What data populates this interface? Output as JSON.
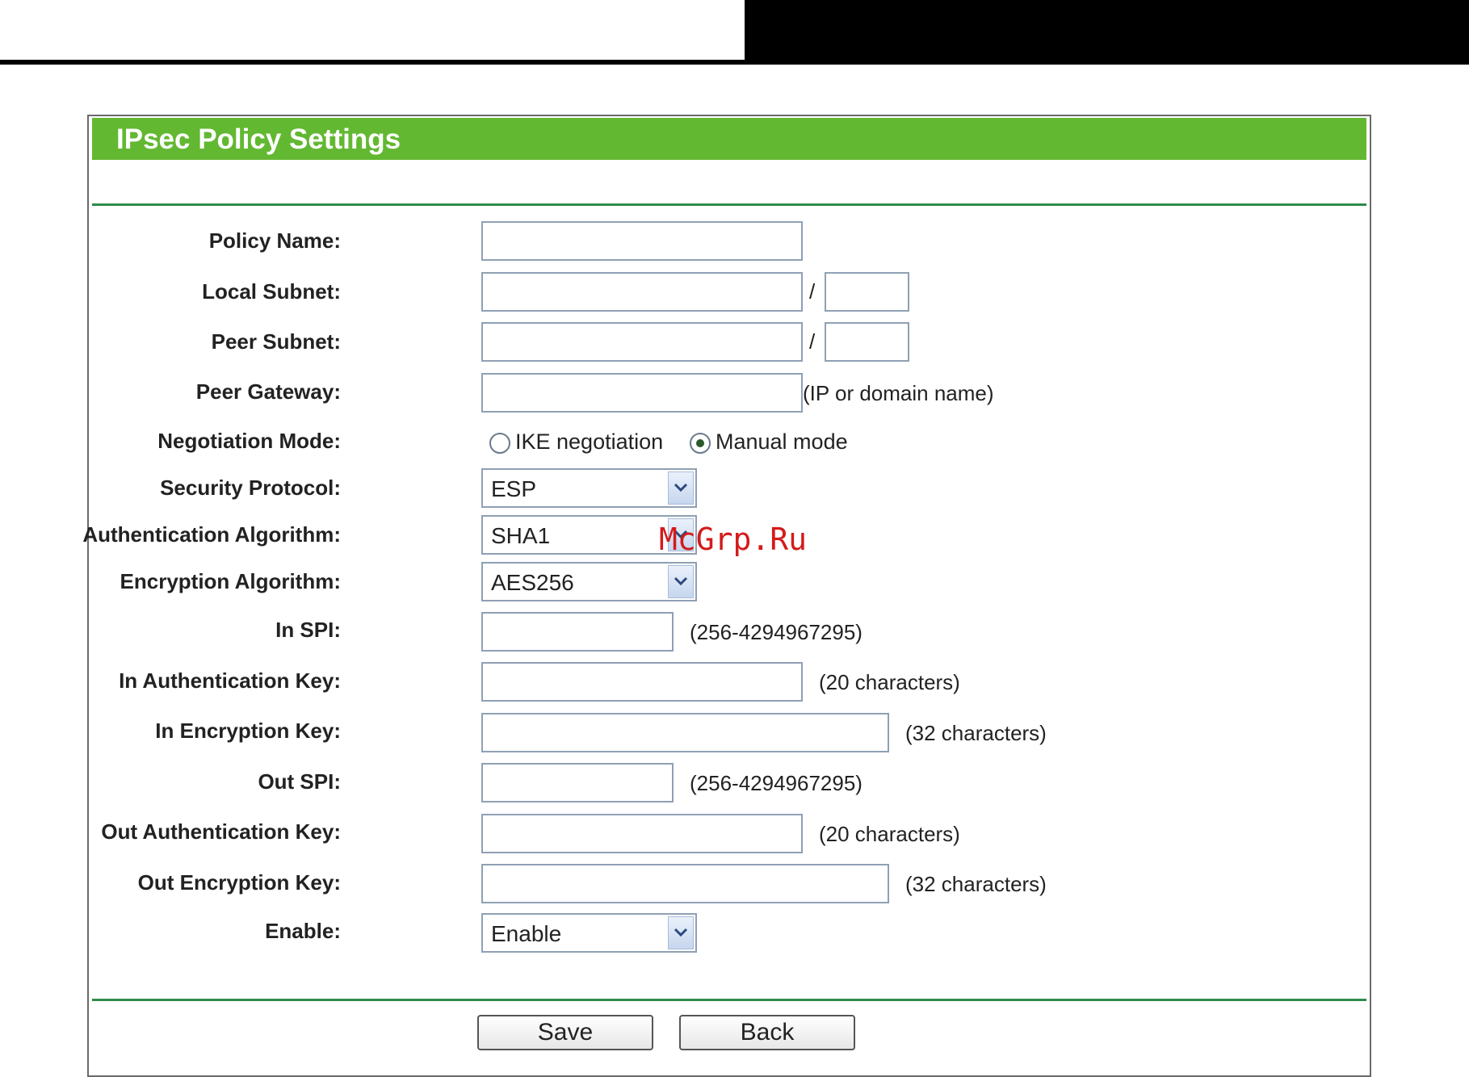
{
  "panel": {
    "title": "IPsec Policy Settings"
  },
  "form": {
    "policy_name": {
      "label": "Policy Name:",
      "value": ""
    },
    "local_subnet": {
      "label": "Local Subnet:",
      "value": "",
      "mask": "",
      "separator": "/"
    },
    "peer_subnet": {
      "label": "Peer Subnet:",
      "value": "",
      "mask": "",
      "separator": "/"
    },
    "peer_gateway": {
      "label": "Peer Gateway:",
      "value": "",
      "hint": "(IP or domain name)"
    },
    "negotiation_mode": {
      "label": "Negotiation Mode:",
      "options": [
        "IKE negotiation",
        "Manual mode"
      ],
      "selected": "Manual mode"
    },
    "security_protocol": {
      "label": "Security Protocol:",
      "value": "ESP"
    },
    "auth_algorithm": {
      "label": "Authentication Algorithm:",
      "value": "SHA1"
    },
    "encryption_algorithm": {
      "label": "Encryption Algorithm:",
      "value": "AES256"
    },
    "in_spi": {
      "label": "In SPI:",
      "value": "",
      "hint": "(256-4294967295)"
    },
    "in_auth_key": {
      "label": "In Authentication Key:",
      "value": "",
      "hint": "(20 characters)"
    },
    "in_enc_key": {
      "label": "In Encryption Key:",
      "value": "",
      "hint": "(32 characters)"
    },
    "out_spi": {
      "label": "Out SPI:",
      "value": "",
      "hint": "(256-4294967295)"
    },
    "out_auth_key": {
      "label": "Out Authentication Key:",
      "value": "",
      "hint": "(20 characters)"
    },
    "out_enc_key": {
      "label": "Out Encryption Key:",
      "value": "",
      "hint": "(32 characters)"
    },
    "enable": {
      "label": "Enable:",
      "value": "Enable"
    }
  },
  "buttons": {
    "save": "Save",
    "back": "Back"
  },
  "watermark": "McGrp.Ru",
  "colors": {
    "header": "#63b832",
    "rule": "#2f8a4a",
    "watermark": "#d41a1a"
  },
  "icons": {
    "dropdown": "chevron-down-icon",
    "radio": "radio-icon"
  }
}
